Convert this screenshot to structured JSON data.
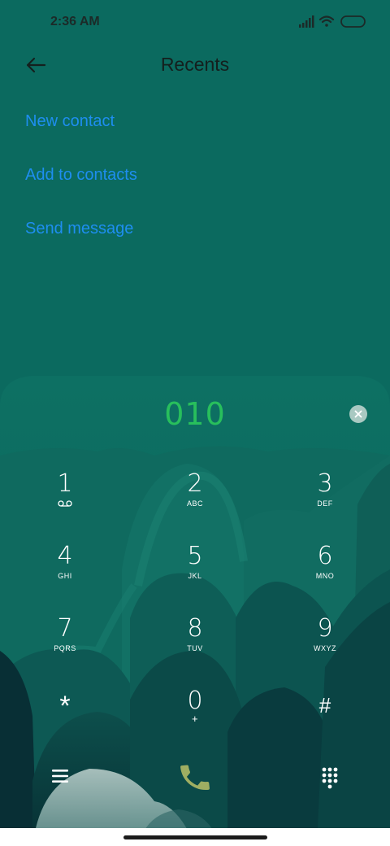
{
  "status_bar": {
    "time": "2:36 AM",
    "icons": [
      "signal-icon",
      "wifi-icon",
      "battery-icon"
    ]
  },
  "header": {
    "title": "Recents",
    "back_icon": "back-arrow-icon"
  },
  "actions": [
    {
      "label": "New contact"
    },
    {
      "label": "Add to contacts"
    },
    {
      "label": "Send message"
    }
  ],
  "dialer": {
    "number": "010",
    "keys": [
      {
        "digit": "1",
        "letters": ""
      },
      {
        "digit": "2",
        "letters": "ABC"
      },
      {
        "digit": "3",
        "letters": "DEF"
      },
      {
        "digit": "4",
        "letters": "GHI"
      },
      {
        "digit": "5",
        "letters": "JKL"
      },
      {
        "digit": "6",
        "letters": "MNO"
      },
      {
        "digit": "7",
        "letters": "PQRS"
      },
      {
        "digit": "8",
        "letters": "TUV"
      },
      {
        "digit": "9",
        "letters": "WXYZ"
      },
      {
        "digit": "*",
        "letters": ""
      },
      {
        "digit": "0",
        "letters": "+"
      },
      {
        "digit": "#",
        "letters": ""
      }
    ]
  },
  "bottom_bar": {
    "menu_icon": "menu-icon",
    "call_icon": "phone-icon",
    "keypad_icon": "keypad-icon"
  },
  "colors": {
    "background": "#0b6a5f",
    "link": "#1e8ef0",
    "number": "#28bf5c",
    "call": "#9fae62"
  }
}
